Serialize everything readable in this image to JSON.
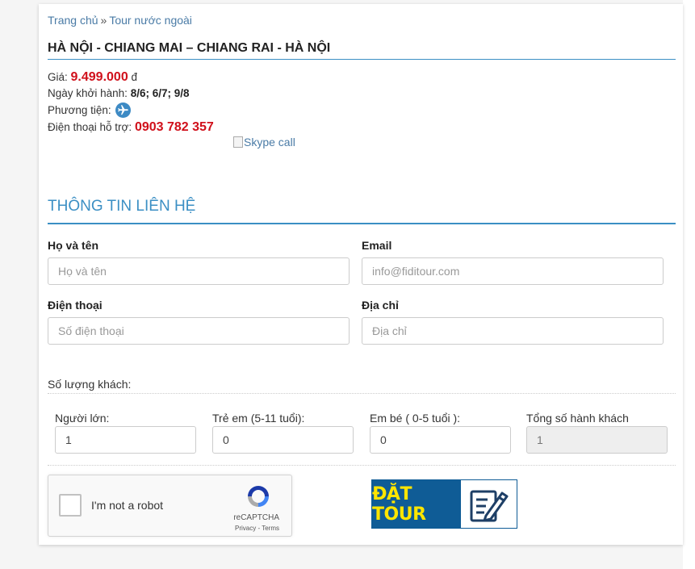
{
  "breadcrumb": {
    "home": "Trang chủ",
    "separator": "»",
    "current": "Tour nước ngoài"
  },
  "tour": {
    "title": "HÀ NỘI - CHIANG MAI – CHIANG RAI - HÀ NỘI",
    "price_label": "Giá:",
    "price_value": "9.499.000",
    "price_currency": "đ",
    "departure_label": "Ngày khởi hành:",
    "departure_value": "8/6; 6/7; 9/8",
    "transport_label": "Phương tiện:",
    "transport_icon": "airplane-icon",
    "phone_label": "Điện thoại hỗ trợ:",
    "phone_value": "0903 782 357",
    "skype_alt": "Skype call"
  },
  "contact": {
    "section_title": "THÔNG TIN LIÊN HỆ",
    "name_label": "Họ và tên",
    "name_placeholder": "Họ và tên",
    "email_label": "Email",
    "email_placeholder": "info@fiditour.com",
    "phone_label": "Điện thoại",
    "phone_placeholder": "Số điện thoại",
    "address_label": "Địa chỉ",
    "address_placeholder": "Địa chỉ"
  },
  "guests": {
    "section_label": "Số lượng khách:",
    "adults_label": "Người lớn:",
    "adults_value": "1",
    "children_label": "Trẻ em (5-11 tuổi):",
    "children_value": "0",
    "infants_label": "Em bé ( 0-5 tuổi ):",
    "infants_value": "0",
    "total_label": "Tổng số hành khách",
    "total_value": "1"
  },
  "recaptcha": {
    "checkbox_label": "I'm not a robot",
    "brand": "reCAPTCHA",
    "links": "Privacy - Terms"
  },
  "book_button": {
    "label": "ĐẶT TOUR",
    "icon": "pencil-document-icon"
  },
  "colors": {
    "accent": "#3b8fc4",
    "price": "#d0101b",
    "button_bg": "#0f5c96",
    "button_text": "#ffe500"
  }
}
